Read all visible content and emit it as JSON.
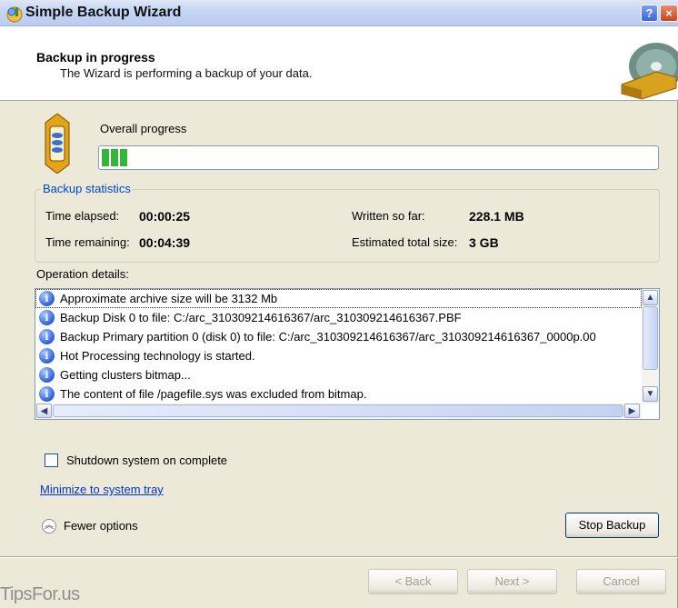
{
  "window": {
    "title": "Simple Backup Wizard",
    "help_glyph": "?",
    "close_glyph": "×",
    "icon": "backup-wizard-icon"
  },
  "header": {
    "title": "Backup in progress",
    "subtitle": "The Wizard is performing a backup of your data.",
    "graphic": "disk-backup-graphic"
  },
  "progress": {
    "label": "Overall progress",
    "percent": 5,
    "fill_color": "#37b43a"
  },
  "stats": {
    "legend": "Backup statistics",
    "time_elapsed_label": "Time elapsed:",
    "time_elapsed_value": "00:00:25",
    "time_remaining_label": "Time remaining:",
    "time_remaining_value": "00:04:39",
    "written_label": "Written so far:",
    "written_value": "228.1 MB",
    "total_label": "Estimated total size:",
    "total_value": "3 GB"
  },
  "operations": {
    "label": "Operation details:",
    "icon": "info-icon",
    "items": [
      "Approximate archive size will be 3132 Mb",
      "Backup Disk 0 to file: C:/arc_310309214616367/arc_310309214616367.PBF",
      "Backup Primary partition 0 (disk 0) to file: C:/arc_310309214616367/arc_310309214616367_0000p.00",
      "Hot Processing technology is started.",
      "Getting clusters bitmap...",
      "The content of file /pagefile.sys was excluded from bitmap."
    ]
  },
  "options": {
    "shutdown_label": "Shutdown system on complete",
    "shutdown_checked": false,
    "minimize_link": "Minimize to system tray",
    "fewer_label": "Fewer options"
  },
  "buttons": {
    "stop": "Stop Backup",
    "back": "< Back",
    "next": "Next >",
    "cancel": "Cancel"
  },
  "watermark": "TipsFor.us"
}
